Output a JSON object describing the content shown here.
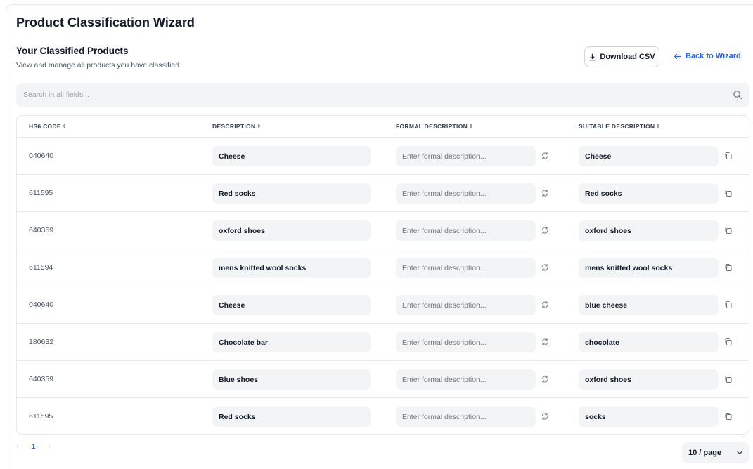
{
  "page": {
    "title": "Product Classification Wizard",
    "section_title": "Your Classified Products",
    "section_subtitle": "View and manage all products you have classified",
    "download_label": "Download CSV",
    "back_label": "Back to Wizard",
    "search_placeholder": "Search in all fields..."
  },
  "table": {
    "headers": {
      "code": "HS6 CODE",
      "description": "DESCRIPTION",
      "formal": "FORMAL DESCRIPTION",
      "suitable": "SUITABLE DESCRIPTION"
    },
    "formal_placeholder": "Enter formal description...",
    "rows": [
      {
        "code": "040640",
        "description": "Cheese",
        "suitable": "Cheese"
      },
      {
        "code": "611595",
        "description": "Red socks",
        "suitable": "Red socks"
      },
      {
        "code": "640359",
        "description": "oxford shoes",
        "suitable": "oxford shoes"
      },
      {
        "code": "611594",
        "description": "mens knitted wool socks",
        "suitable": "mens knitted wool socks"
      },
      {
        "code": "040640",
        "description": "Cheese",
        "suitable": "blue cheese"
      },
      {
        "code": "180632",
        "description": "Chocolate bar",
        "suitable": "chocolate"
      },
      {
        "code": "640359",
        "description": "Blue shoes",
        "suitable": "oxford shoes"
      },
      {
        "code": "611595",
        "description": "Red socks",
        "suitable": "socks"
      }
    ]
  },
  "pagination": {
    "current_page": "1",
    "page_size_label": "10 / page"
  },
  "icons": {
    "download": "download-icon",
    "back": "arrow-left-icon",
    "search": "search-icon",
    "sort": "sort-icon",
    "refresh": "refresh-icon",
    "copy": "copy-icon",
    "chevron": "chevron-down-icon"
  },
  "colors": {
    "accent": "#2563eb",
    "field_bg": "#f3f4f6",
    "border": "#e5e7eb"
  }
}
